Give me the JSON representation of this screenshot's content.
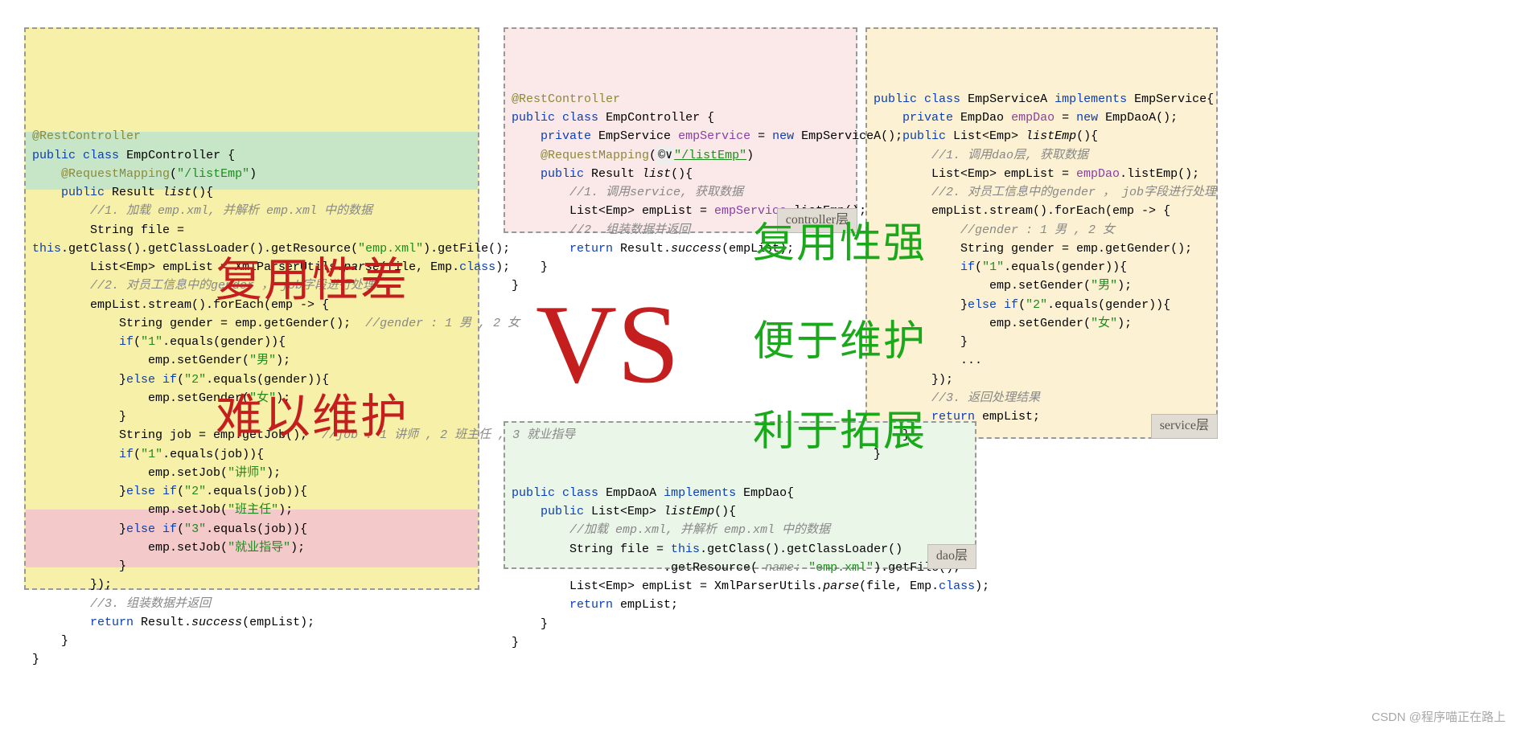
{
  "overlay": {
    "vs": "VS",
    "bad1": "复用性差",
    "bad2": "难以维护",
    "good1": "复用性强",
    "good2": "便于维护",
    "good3": "利于拓展"
  },
  "tags": {
    "controller": "controller层",
    "service": "service层",
    "dao": "dao层"
  },
  "watermark": "CSDN @程序喵正在路上",
  "left": {
    "l01a": "@RestController",
    "l02a": "public",
    "l02b": "class",
    "l02c": "EmpController {",
    "l03a": "@RequestMapping",
    "l03b": "(",
    "l03c": "\"/listEmp\"",
    "l03d": ")",
    "l04a": "public",
    "l04b": "Result ",
    "l04c": "list",
    "l04d": "(){",
    "l05": "//1. 加载 emp.xml, 并解析 emp.xml 中的数据",
    "l06": "String file =",
    "l07a": "this",
    "l07b": ".getClass().getClassLoader().getResource(",
    "l07c": "\"emp.xml\"",
    "l07d": ").getFile();",
    "l08a": "List<Emp> empList = XmlParserUtils.",
    "l08b": "parse",
    "l08c": "(file, Emp.",
    "l08d": "class",
    "l08e": ");",
    "l09": "//2. 对员工信息中的gender ， job字段进行处理",
    "l10": "empList.stream().forEach(emp -> {",
    "l11a": "String gender = emp.getGender();  ",
    "l11b": "//gender : 1 男 , 2 女",
    "l12a": "if",
    "l12b": "(",
    "l12c": "\"1\"",
    "l12d": ".equals(gender)){",
    "l13a": "emp.setGender(",
    "l13b": "\"男\"",
    "l13c": ");",
    "l14a": "}",
    "l14b": "else if",
    "l14c": "(",
    "l14d": "\"2\"",
    "l14e": ".equals(gender)){",
    "l15a": "emp.setGender(",
    "l15b": "\"女\"",
    "l15c": ");",
    "l16": "}",
    "l17a": "String job = emp.getJob();  ",
    "l17b": "//job : 1 讲师 , 2 班主任 , 3 就业指导",
    "l18a": "if",
    "l18b": "(",
    "l18c": "\"1\"",
    "l18d": ".equals(job)){",
    "l19a": "emp.setJob(",
    "l19b": "\"讲师\"",
    "l19c": ");",
    "l20a": "}",
    "l20b": "else if",
    "l20c": "(",
    "l20d": "\"2\"",
    "l20e": ".equals(job)){",
    "l21a": "emp.setJob(",
    "l21b": "\"班主任\"",
    "l21c": ");",
    "l22a": "}",
    "l22b": "else if",
    "l22c": "(",
    "l22d": "\"3\"",
    "l22e": ".equals(job)){",
    "l23a": "emp.setJob(",
    "l23b": "\"就业指导\"",
    "l23c": ");",
    "l24": "}",
    "l25": "});",
    "l26": "//3. 组装数据并返回",
    "l27a": "return",
    "l27b": " Result.",
    "l27c": "success",
    "l27d": "(empList);",
    "l28": "}",
    "l29": "}"
  },
  "ctrl": {
    "c01": "@RestController",
    "c02a": "public",
    "c02b": "class",
    "c02c": "EmpController {",
    "c03a": "private",
    "c03b": "EmpService ",
    "c03c": "empService",
    "c03d": " = ",
    "c03e": "new",
    "c03f": " EmpServiceA();",
    "c04a": "@RequestMapping",
    "c04b": "(",
    "c04c": "©∨",
    "c04d": "\"/listEmp\"",
    "c04e": ")",
    "c05a": "public",
    "c05b": "Result ",
    "c05c": "list",
    "c05d": "(){",
    "c06": "//1. 调用service, 获取数据",
    "c07a": "List<Emp> empList = ",
    "c07b": "empService",
    "c07c": ".listEmp();",
    "c08": "//2. 组装数据并返回",
    "c09a": "return",
    "c09b": " Result.",
    "c09c": "success",
    "c09d": "(empList);",
    "c10": "}",
    "c11": "}"
  },
  "svc": {
    "s01a": "public",
    "s01b": "class",
    "s01c": "EmpServiceA ",
    "s01d": "implements",
    "s01e": " EmpService{",
    "s02a": "private",
    "s02b": "EmpDao ",
    "s02c": "empDao",
    "s02d": " = ",
    "s02e": "new",
    "s02f": " EmpDaoA();",
    "s03a": "public",
    "s03b": "List<Emp> ",
    "s03c": "listEmp",
    "s03d": "(){",
    "s04": "//1. 调用dao层, 获取数据",
    "s05a": "List<Emp> empList = ",
    "s05b": "empDao",
    "s05c": ".listEmp();",
    "s06": "//2. 对员工信息中的gender ， job字段进行处理",
    "s07": "empList.stream().forEach(emp -> {",
    "s08": "//gender : 1 男 , 2 女",
    "s09": "String gender = emp.getGender();",
    "s10a": "if",
    "s10b": "(",
    "s10c": "\"1\"",
    "s10d": ".equals(gender)){",
    "s11a": "emp.setGender(",
    "s11b": "\"男\"",
    "s11c": ");",
    "s12a": "}",
    "s12b": "else if",
    "s12c": "(",
    "s12d": "\"2\"",
    "s12e": ".equals(gender)){",
    "s13a": "emp.setGender(",
    "s13b": "\"女\"",
    "s13c": ");",
    "s14": "}",
    "s15": "...",
    "s16": "});",
    "s17": "//3. 返回处理结果",
    "s18a": "return",
    "s18b": " empList;",
    "s19": "}",
    "s20": "}"
  },
  "dao": {
    "d01a": "public",
    "d01b": "class",
    "d01c": "EmpDaoA ",
    "d01d": "implements",
    "d01e": " EmpDao{",
    "d02a": "public",
    "d02b": "List<Emp> ",
    "d02c": "listEmp",
    "d02d": "(){",
    "d03": "//加载 emp.xml, 并解析 emp.xml 中的数据",
    "d04a": "String file = ",
    "d04b": "this",
    "d04c": ".getClass().getClassLoader()",
    "d05a": ".getResource( ",
    "d05b": "name:",
    "d05c": " \"emp.xml\"",
    "d05d": ").getFile();",
    "d06a": "List<Emp> empList = XmlParserUtils.",
    "d06b": "parse",
    "d06c": "(file, Emp.",
    "d06d": "class",
    "d06e": ");",
    "d07a": "return",
    "d07b": " empList;",
    "d08": "}",
    "d09": "}"
  }
}
